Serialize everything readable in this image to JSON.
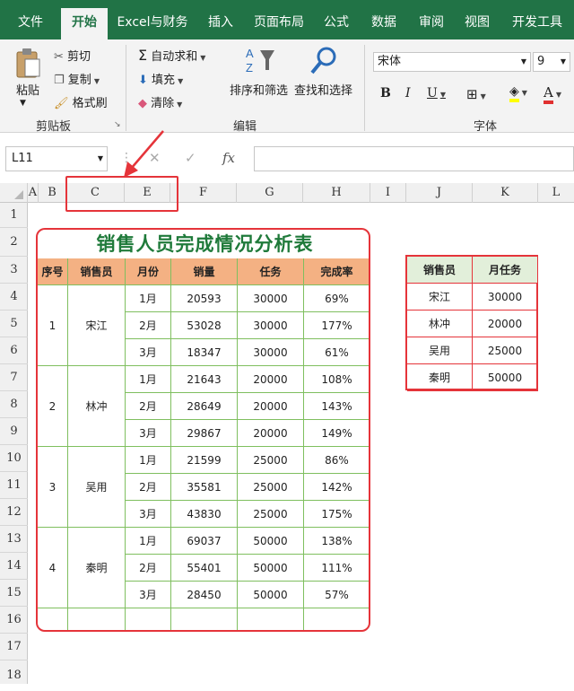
{
  "ribbon_tabs": [
    "文件",
    "开始",
    "Excel与财务",
    "插入",
    "页面布局",
    "公式",
    "数据",
    "审阅",
    "视图",
    "开发工具"
  ],
  "ribbon": {
    "paste": "粘贴",
    "cut": "剪切",
    "copy": "复制",
    "format_painter": "格式刷",
    "clipboard_group": "剪贴板",
    "autosum": "自动求和",
    "fill": "填充",
    "clear": "清除",
    "sort_filter": "排序和筛选",
    "find_select": "查找和选择",
    "edit_group": "编辑",
    "font_name": "宋体",
    "font_size": "9",
    "bold": "B",
    "italic": "I",
    "underline": "U",
    "font_color_letter": "A",
    "font_group": "字体"
  },
  "formula_bar": {
    "name_box": "L11",
    "cancel": "✕",
    "enter": "✓",
    "fx": "fx"
  },
  "columns": [
    "A",
    "B",
    "C",
    "E",
    "F",
    "G",
    "H",
    "I",
    "J",
    "K",
    "L"
  ],
  "rows": [
    "1",
    "2",
    "3",
    "4",
    "5",
    "6",
    "7",
    "8",
    "9",
    "10",
    "11",
    "12",
    "13",
    "14",
    "15",
    "16",
    "17",
    "18"
  ],
  "main_table": {
    "title": "销售人员完成情况分析表",
    "headers": [
      "序号",
      "销售员",
      "月份",
      "销量",
      "任务",
      "完成率"
    ],
    "groups": [
      {
        "no": "1",
        "name": "宋江",
        "rows": [
          [
            "1月",
            "20593",
            "30000",
            "69%"
          ],
          [
            "2月",
            "53028",
            "30000",
            "177%"
          ],
          [
            "3月",
            "18347",
            "30000",
            "61%"
          ]
        ]
      },
      {
        "no": "2",
        "name": "林冲",
        "rows": [
          [
            "1月",
            "21643",
            "20000",
            "108%"
          ],
          [
            "2月",
            "28649",
            "20000",
            "143%"
          ],
          [
            "3月",
            "29867",
            "20000",
            "149%"
          ]
        ]
      },
      {
        "no": "3",
        "name": "吴用",
        "rows": [
          [
            "1月",
            "21599",
            "25000",
            "86%"
          ],
          [
            "2月",
            "35581",
            "25000",
            "142%"
          ],
          [
            "3月",
            "43830",
            "25000",
            "175%"
          ]
        ]
      },
      {
        "no": "4",
        "name": "秦明",
        "rows": [
          [
            "1月",
            "69037",
            "50000",
            "138%"
          ],
          [
            "2月",
            "55401",
            "50000",
            "111%"
          ],
          [
            "3月",
            "28450",
            "50000",
            "57%"
          ]
        ]
      }
    ]
  },
  "side_table": {
    "headers": [
      "销售员",
      "月任务"
    ],
    "rows": [
      [
        "宋江",
        "30000"
      ],
      [
        "林冲",
        "20000"
      ],
      [
        "吴用",
        "25000"
      ],
      [
        "秦明",
        "50000"
      ]
    ]
  },
  "colors": {
    "ribbon": "#217346",
    "accent_red": "#e5343a",
    "header_orange": "#f4b183",
    "header_green": "#e2efda",
    "title_green": "#1f7a3a"
  }
}
